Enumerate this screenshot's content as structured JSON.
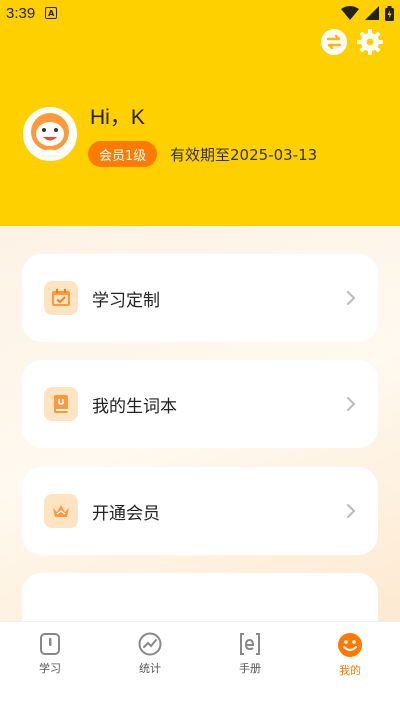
{
  "status_bar": {
    "time": "3:39",
    "a_badge": "A"
  },
  "header": {
    "greeting": "Hi，K",
    "member_badge": "会员1级",
    "validity": "有效期至2025-03-13"
  },
  "menu": [
    {
      "label": "学习定制",
      "icon": "calendar-icon"
    },
    {
      "label": "我的生词本",
      "icon": "book-icon"
    },
    {
      "label": "开通会员",
      "icon": "crown-icon"
    }
  ],
  "tabs": [
    {
      "label": "学习",
      "icon": "study-icon"
    },
    {
      "label": "统计",
      "icon": "stats-icon"
    },
    {
      "label": "手册",
      "icon": "handbook-icon"
    },
    {
      "label": "我的",
      "icon": "smiley-icon",
      "active": true
    }
  ],
  "colors": {
    "header_bg": "#ffd000",
    "accent": "#ff7a00",
    "icon_bg": "#ffe4c4"
  }
}
